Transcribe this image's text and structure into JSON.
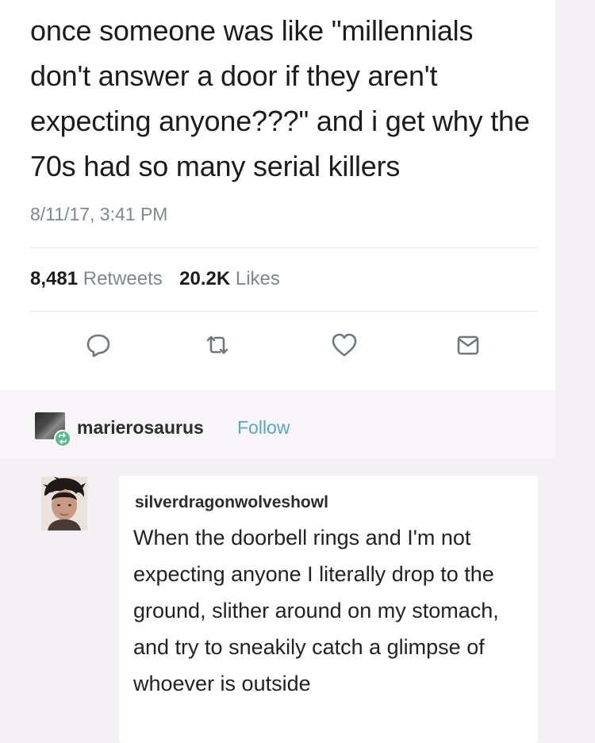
{
  "tweet": {
    "text": "once someone was like \"millennials don't answer a door if they aren't expecting anyone???\" and i get why the 70s had so many serial killers",
    "timestamp": "8/11/17, 3:41 PM",
    "retweets_count": "8,481",
    "retweets_label": "Retweets",
    "likes_count": "20.2K",
    "likes_label": "Likes",
    "actions": [
      "reply-icon",
      "retweet-icon",
      "heart-icon",
      "message-icon"
    ]
  },
  "reblog": {
    "username": "marierosaurus",
    "follow_label": "Follow",
    "badge_icon": "reblog-icon"
  },
  "reply": {
    "username": "silverdragonwolveshowl",
    "text": "When the doorbell rings and I'm not expecting anyone I literally drop to the ground, slither around on my stomach, and try to sneakily catch a glimpse of whoever is outside"
  },
  "colors": {
    "link": "#5aa6c8",
    "muted": "#7f8790",
    "reblog_badge": "#56bc8a"
  }
}
